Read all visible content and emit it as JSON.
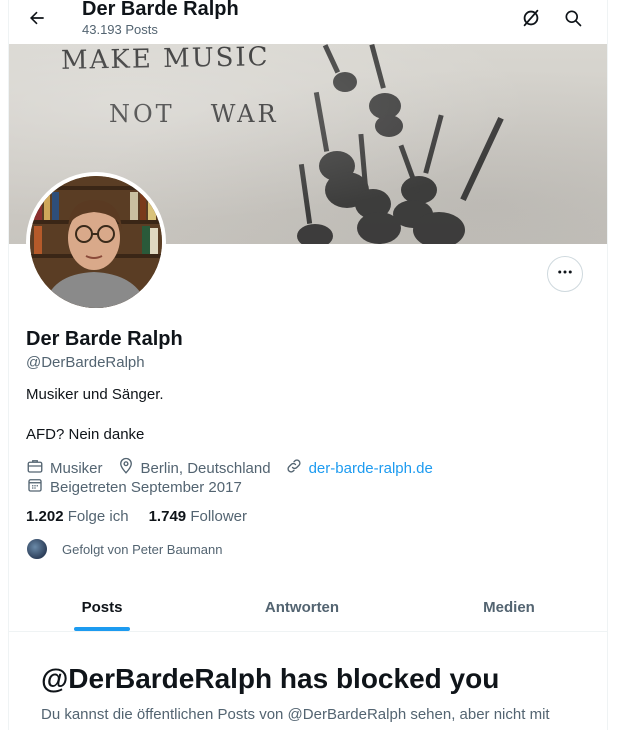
{
  "header": {
    "title": "Der Barde Ralph",
    "post_count": "43.193 Posts"
  },
  "banner": {
    "line1": "MAKE MUSIC",
    "line2_a": "NOT",
    "line2_b": "WAR"
  },
  "profile": {
    "name": "Der Barde Ralph",
    "handle": "@DerBardeRalph",
    "bio_line1": "Musiker und Sänger.",
    "bio_line2": "AFD? Nein danke",
    "category": "Musiker",
    "location": "Berlin, Deutschland",
    "website": "der-barde-ralph.de",
    "joined": "Beigetreten September 2017",
    "following_count": "1.202",
    "following_label": "Folge ich",
    "followers_count": "1.749",
    "followers_label": "Follower",
    "followed_by": "Gefolgt von Peter Baumann"
  },
  "tabs": [
    {
      "label": "Posts",
      "active": true
    },
    {
      "label": "Antworten",
      "active": false
    },
    {
      "label": "Medien",
      "active": false
    }
  ],
  "blocked": {
    "title": "@DerBardeRalph has blocked you",
    "text": "Du kannst die öffentlichen Posts von @DerBardeRalph sehen, aber nicht mit"
  },
  "icons": {
    "back": "arrow-left-icon",
    "grok": "slashed-circle-icon",
    "search": "search-icon",
    "more": "more-icon",
    "category": "briefcase-icon",
    "location": "location-pin-icon",
    "website": "link-icon",
    "joined": "calendar-icon"
  },
  "colors": {
    "accent": "#1d9bf0",
    "text": "#0f1419",
    "secondary": "#536471"
  }
}
